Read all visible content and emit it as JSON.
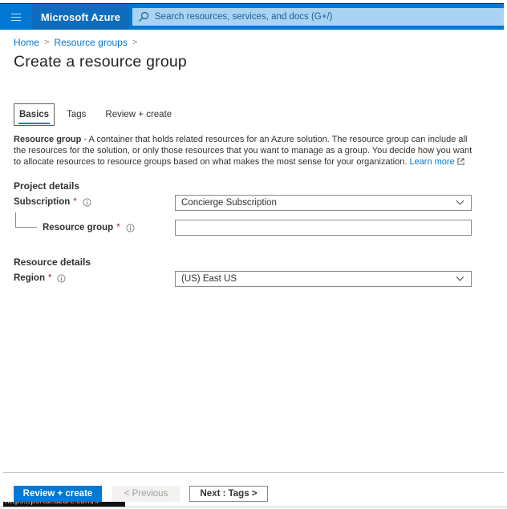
{
  "topbar": {
    "menu_icon": "hamburger-menu-icon",
    "brand": "Microsoft Azure",
    "search": {
      "icon": "search-icon",
      "placeholder": "Search resources, services, and docs (G+/)",
      "value": ""
    }
  },
  "breadcrumb": {
    "items": [
      {
        "label": "Home"
      },
      {
        "label": "Resource groups"
      }
    ],
    "separator": ">"
  },
  "page": {
    "title": "Create a resource group"
  },
  "tabs": [
    {
      "label": "Basics",
      "active": true
    },
    {
      "label": "Tags",
      "active": false
    },
    {
      "label": "Review + create",
      "active": false
    }
  ],
  "description": {
    "term": "Resource group",
    "text": " - A container that holds related resources for an Azure solution. The resource group can include all the resources for the solution, or only those resources that you want to manage as a group. You decide how you want to allocate resources to resource groups based on what makes the most sense for your organization. ",
    "link_label": "Learn more",
    "link_icon": "external-link-icon"
  },
  "project_details": {
    "title": "Project details",
    "subscription": {
      "label": "Subscription",
      "required_mark": "*",
      "info_icon": "info-icon",
      "value": "Concierge Subscription",
      "control_icon": "chevron-down-icon"
    },
    "resource_group": {
      "label": "Resource group",
      "required_mark": "*",
      "info_icon": "info-icon",
      "value": "",
      "placeholder": ""
    }
  },
  "resource_details": {
    "title": "Resource details",
    "region": {
      "label": "Region",
      "required_mark": "*",
      "info_icon": "info-icon",
      "value": "(US) East US",
      "control_icon": "chevron-down-icon"
    }
  },
  "footer": {
    "review_create_label": "Review + create",
    "previous_label": "< Previous",
    "next_label": "Next : Tags >",
    "status_tip": "https://portal.azure.com/#"
  },
  "colors": {
    "accent": "#0078d4",
    "brand_block": "#0f6cbd",
    "search_bg": "#a9d3f2",
    "required": "#a4262c"
  }
}
